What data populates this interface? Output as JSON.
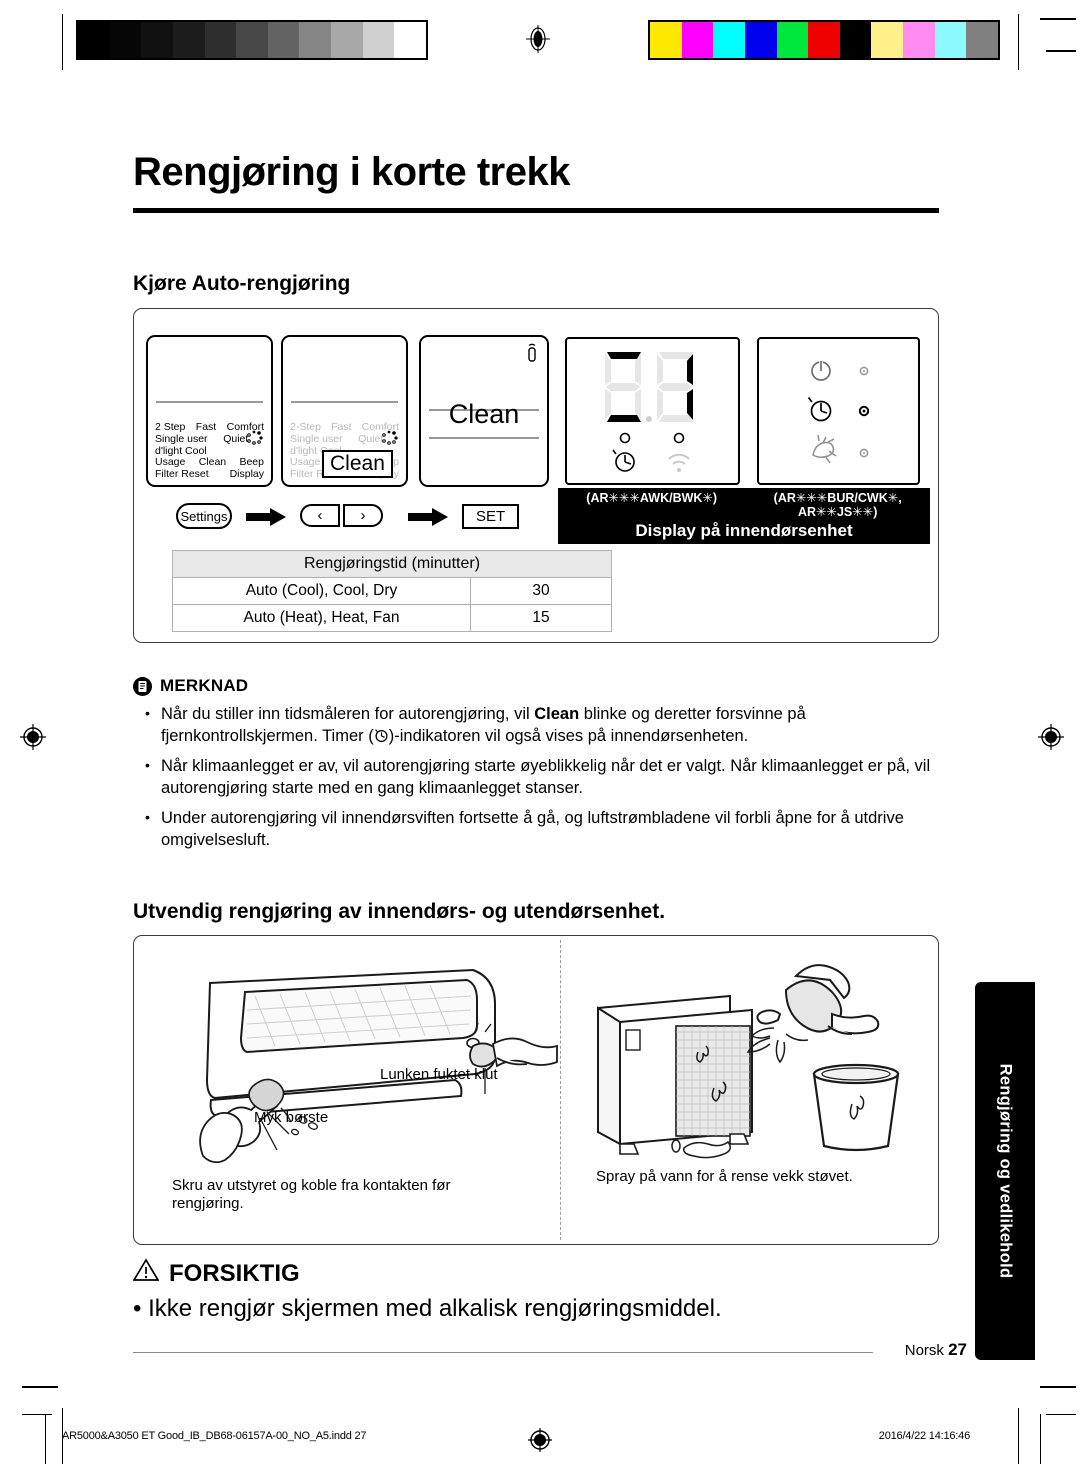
{
  "page": {
    "title": "Rengjøring i korte trekk",
    "section1_heading": "Kjøre Auto-rengjøring",
    "section2_heading": "Utvendig rengjøring av innendørs- og utendørsenhet.",
    "side_tab": "Rengjøring og vedlikehold",
    "footer_language": "Norsk",
    "footer_page_number": "27"
  },
  "procedure": {
    "remote1": {
      "lines": [
        [
          "2 Step",
          "Fast",
          "Comfort"
        ],
        [
          "Single user",
          "Quiet",
          ""
        ],
        [
          "d'light Cool",
          "",
          ""
        ],
        [
          "Usage",
          "Clean",
          "Beep"
        ],
        [
          "Filter Reset",
          "",
          "Display"
        ]
      ]
    },
    "remote2": {
      "lines": [
        [
          "2-Step",
          "Fast",
          "Comfort"
        ],
        [
          "Single user",
          "Quiet",
          ""
        ],
        [
          "d'light Cool",
          "",
          ""
        ],
        [
          "Usage",
          "Clean",
          "Beep"
        ],
        [
          "Filter Reset",
          "",
          "Display"
        ]
      ],
      "overlay_label": "Clean"
    },
    "remote3": {
      "label": "Clean"
    },
    "steps": {
      "settings_button": "Settings",
      "left_key": "‹",
      "right_key": "›",
      "set_button": "SET"
    }
  },
  "indoor_display": {
    "segment_value": "CL",
    "left_panel_icons": [
      "timer-icon",
      "wifi-icon"
    ],
    "right_panel_icons": [
      "power-icon",
      "timer-icon",
      "clean-fan-icon"
    ],
    "model_code_left": "(AR✳✳✳AWK/BWK✳)",
    "model_code_right_line1": "(AR✳✳✳BUR/CWK✳,",
    "model_code_right_line2": "AR✳✳JS✳✳)",
    "caption": "Display på innendørsenhet"
  },
  "table": {
    "header": "Rengjøringstid (minutter)",
    "rows": [
      {
        "mode": "Auto (Cool), Cool, Dry",
        "minutes": "30"
      },
      {
        "mode": "Auto (Heat), Heat, Fan",
        "minutes": "15"
      }
    ]
  },
  "note": {
    "heading": "MERKNAD",
    "icon": "note-document-icon",
    "bullets": [
      {
        "part1": "Når du stiller inn tidsmåleren for autorengjøring, vil ",
        "bold": "Clean",
        "part2": " blinke og deretter forsvinne på fjernkontrollskjermen. Timer (",
        "icon": "timer-icon",
        "part3": ")-indikatoren vil også vises på innendørsenheten."
      },
      {
        "text": "Når klimaanlegget er av, vil autorengjøring starte øyeblikkelig når det er valgt. Når klimaanlegget er på, vil autorengjøring starte med en gang klimaanlegget stanser."
      },
      {
        "text": "Under autorengjøring vil innendørsviften fortsette å gå, og luftstrømbladene vil forbli åpne for å utdrive omgivelsesluft."
      }
    ]
  },
  "illustrations": {
    "left": {
      "label_cloth": "Lunken fuktet klut",
      "label_brush": "Myk børste",
      "caption": "Skru av utstyret og koble fra kontakten før rengjøring."
    },
    "right": {
      "caption": "Spray på vann for å rense vekk støvet."
    }
  },
  "caution": {
    "heading": "FORSIKTIG",
    "icon": "warning-triangle-icon",
    "bullet": "Ikke rengjør skjermen med alkalisk rengjøringsmiddel."
  },
  "print_marks": {
    "filename": "AR5000&A3050 ET Good_IB_DB68-06157A-00_NO_A5.indd   27",
    "datestamp": "2016/4/22   14:16:46",
    "grayscale_swatches": [
      "#000000",
      "#060606",
      "#101010",
      "#1c1c1c",
      "#2e2e2e",
      "#474747",
      "#636363",
      "#858585",
      "#a8a8a8",
      "#d0d0d0",
      "#ffffff"
    ],
    "color_swatches": [
      "#ffe800",
      "#ff00ff",
      "#00ffff",
      "#0000ee",
      "#00e83c",
      "#ee0000",
      "#000000",
      "#fff08a",
      "#ff8cf0",
      "#8cfaff",
      "#808080"
    ]
  }
}
